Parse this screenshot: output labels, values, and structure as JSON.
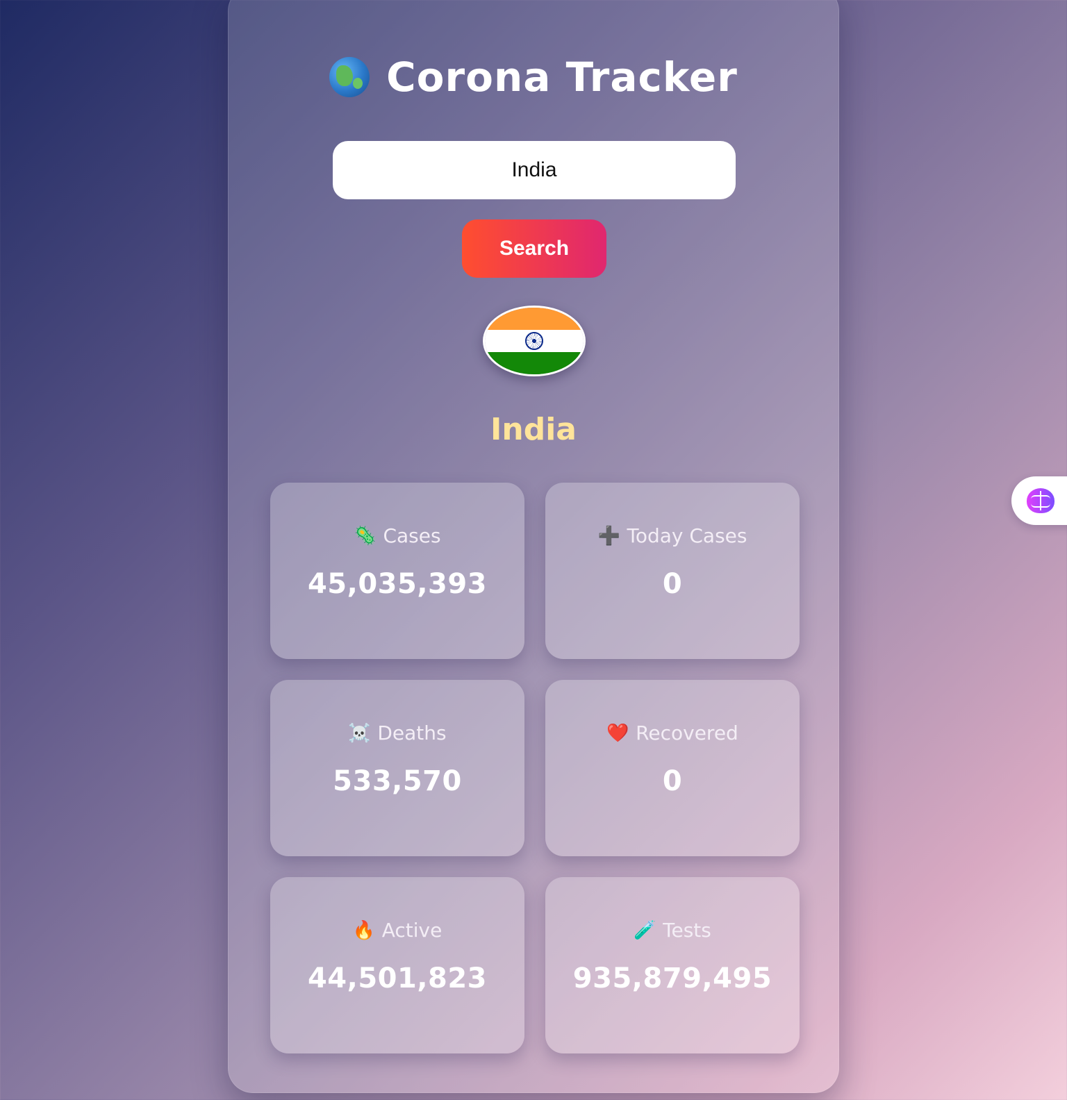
{
  "header": {
    "title": "Corona Tracker",
    "icon": "globe-icon"
  },
  "search": {
    "value": "India",
    "button_label": "Search"
  },
  "country": {
    "name": "India",
    "flag": "india-flag"
  },
  "stats": [
    {
      "icon": "microbe-icon",
      "glyph": "🦠",
      "label": "Cases",
      "value": "45,035,393"
    },
    {
      "icon": "plus-icon",
      "glyph": "➕",
      "label": "Today Cases",
      "value": "0"
    },
    {
      "icon": "skull-icon",
      "glyph": "☠️",
      "label": "Deaths",
      "value": "533,570"
    },
    {
      "icon": "heart-icon",
      "glyph": "❤️",
      "label": "Recovered",
      "value": "0"
    },
    {
      "icon": "fire-icon",
      "glyph": "🔥",
      "label": "Active",
      "value": "44,501,823"
    },
    {
      "icon": "test-tube-icon",
      "glyph": "🧪",
      "label": "Tests",
      "value": "935,879,495"
    }
  ],
  "colors": {
    "accent_gradient_start": "#ff4e2f",
    "accent_gradient_end": "#e0276f",
    "country_name": "#ffe49a"
  },
  "side_widget": {
    "icon": "brain-icon"
  }
}
